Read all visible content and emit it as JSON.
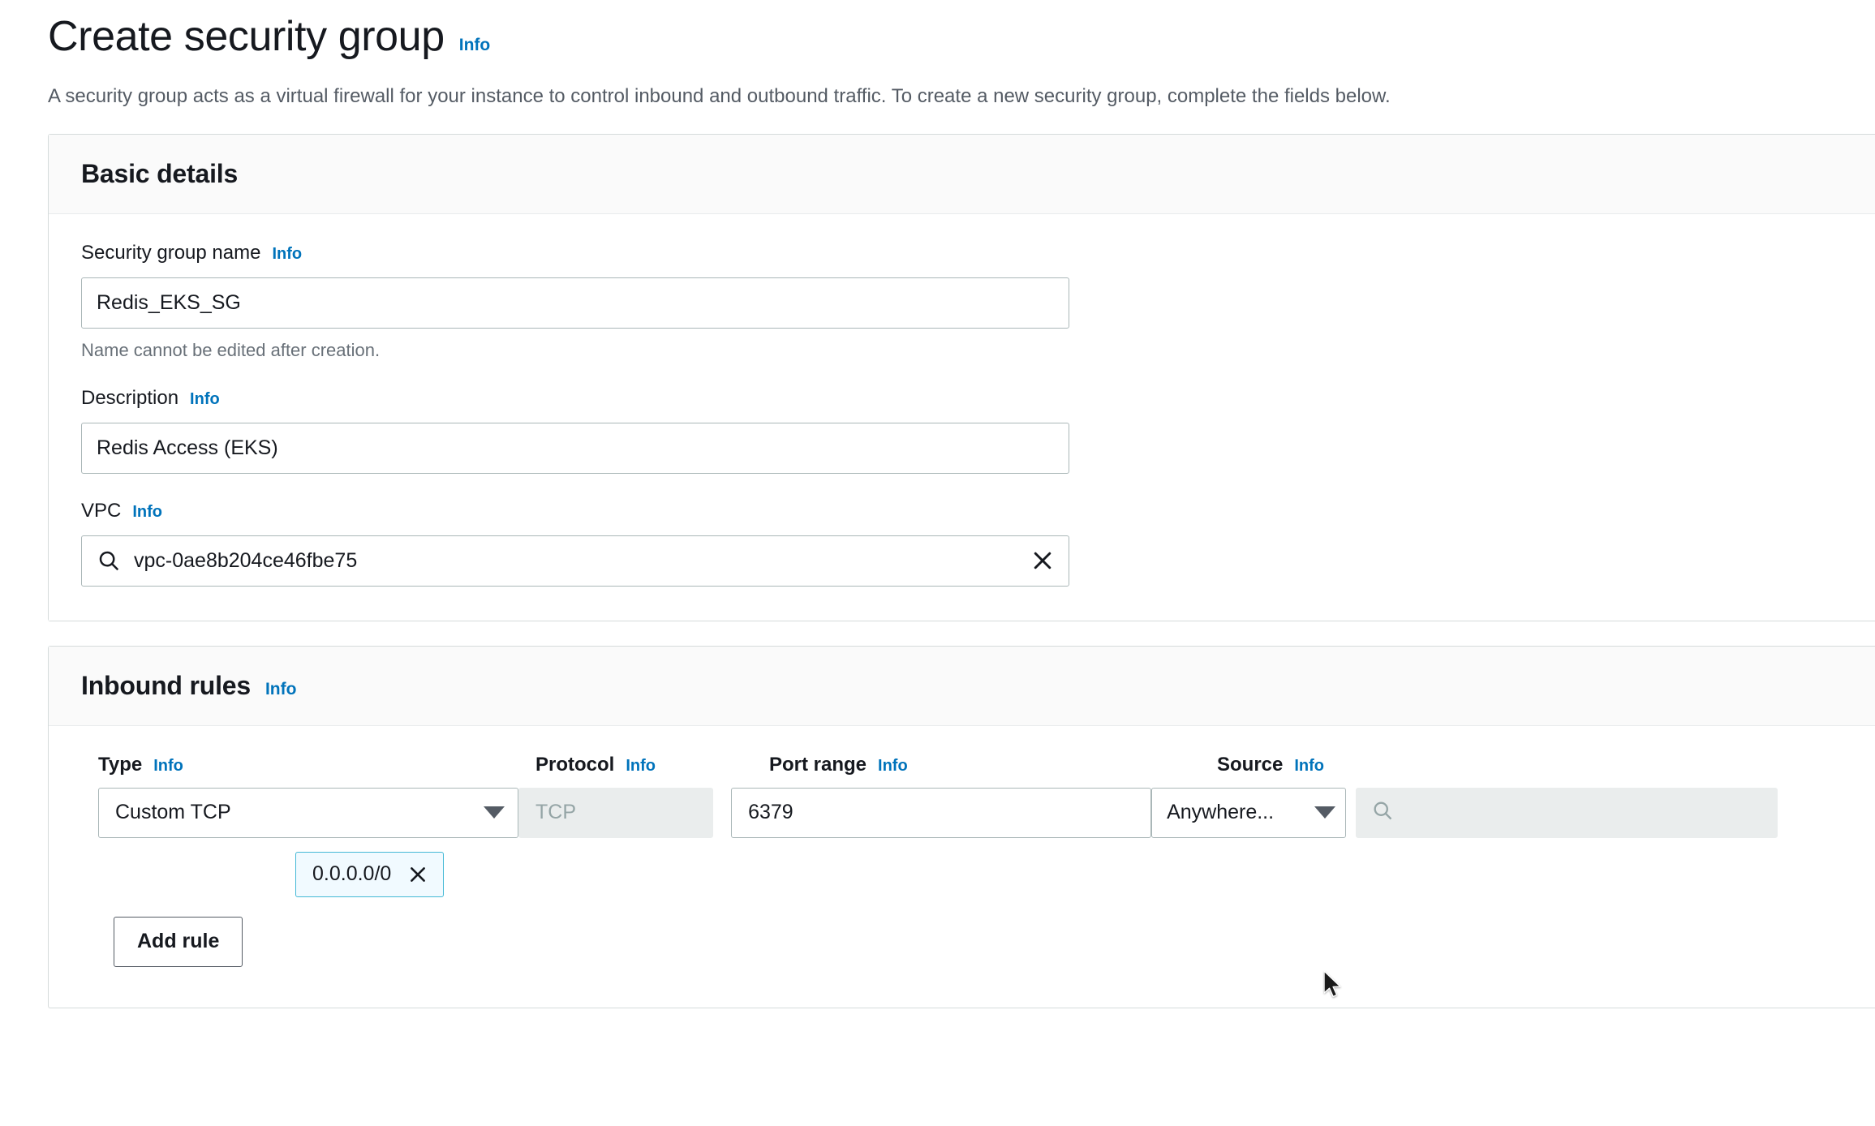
{
  "page": {
    "title": "Create security group",
    "info_label": "Info",
    "description": "A security group acts as a virtual firewall for your instance to control inbound and outbound traffic. To create a new security group, complete the fields below."
  },
  "basic_details": {
    "section_title": "Basic details",
    "name_field": {
      "label": "Security group name",
      "info_label": "Info",
      "value": "Redis_EKS_SG",
      "placeholder": "",
      "hint": "Name cannot be edited after creation."
    },
    "description_field": {
      "label": "Description",
      "info_label": "Info",
      "value": "Redis Access (EKS)",
      "placeholder": ""
    },
    "vpc_field": {
      "label": "VPC",
      "info_label": "Info",
      "value": "vpc-0ae8b204ce46fbe75",
      "placeholder": "",
      "search_icon": "search-icon",
      "clear_icon": "close-icon"
    }
  },
  "inbound_rules": {
    "section_title": "Inbound rules",
    "info_label": "Info",
    "columns": [
      {
        "label": "Type",
        "info_label": "Info"
      },
      {
        "label": "Protocol",
        "info_label": "Info"
      },
      {
        "label": "Port range",
        "info_label": "Info"
      },
      {
        "label": "Source",
        "info_label": "Info"
      }
    ],
    "rows": [
      {
        "type": "Custom TCP",
        "protocol": "TCP",
        "port_range": "6379",
        "source": "Anywhere...",
        "source_search_placeholder": "",
        "source_tokens": [
          "0.0.0.0/0"
        ]
      }
    ],
    "add_rule_label": "Add rule"
  },
  "colors": {
    "link": "#0073bb",
    "token_border": "#44b9d6",
    "border": "#aab7b8",
    "disabled_bg": "#eaeded",
    "muted_text": "#545b64"
  }
}
